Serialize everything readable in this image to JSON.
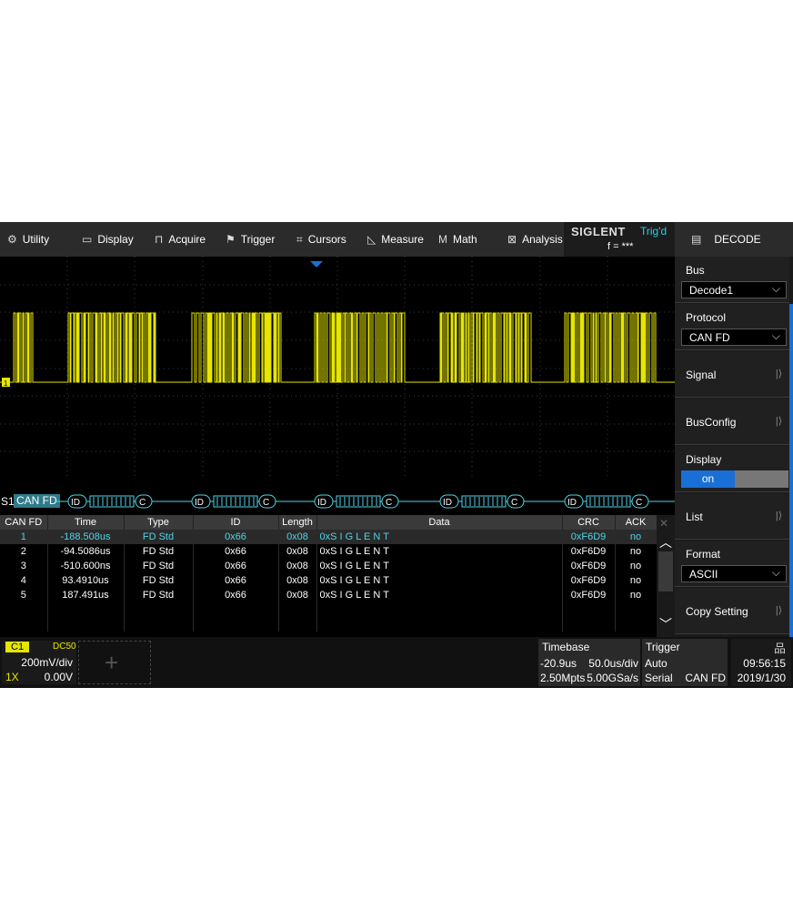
{
  "menu": {
    "items": [
      {
        "label": "Utility",
        "icon": "gear-icon"
      },
      {
        "label": "Display",
        "icon": "monitor-icon"
      },
      {
        "label": "Acquire",
        "icon": "acquire-icon"
      },
      {
        "label": "Trigger",
        "icon": "flag-icon"
      },
      {
        "label": "Cursors",
        "icon": "crosshair-icon"
      },
      {
        "label": "Measure",
        "icon": "measure-icon"
      },
      {
        "label": "Math",
        "icon": "math-icon"
      },
      {
        "label": "Analysis",
        "icon": "analysis-icon"
      }
    ]
  },
  "brand": {
    "logo": "SIGLENT",
    "status": "Trig'd",
    "freq": "f = ***"
  },
  "panel": {
    "title": "DECODE",
    "bus_label": "Bus",
    "bus_value": "Decode1",
    "protocol_label": "Protocol",
    "protocol_value": "CAN FD",
    "signal_label": "Signal",
    "busconfig_label": "BusConfig",
    "display_label": "Display",
    "display_value": "on",
    "list_label": "List",
    "format_label": "Format",
    "format_value": "ASCII",
    "copy_label": "Copy Setting"
  },
  "bus_trace": {
    "label": "S1",
    "protocol": "CAN FD",
    "id_tag": "ID",
    "crc_tag": "C"
  },
  "table": {
    "headers": [
      "CAN FD",
      "Time",
      "Type",
      "ID",
      "Length",
      "Data",
      "CRC",
      "ACK"
    ],
    "rows": [
      [
        "1",
        "-188.508us",
        "FD Std",
        "0x66",
        "0x08",
        "0xS I G L E N T",
        "0xF6D9",
        "no"
      ],
      [
        "2",
        "-94.5086us",
        "FD Std",
        "0x66",
        "0x08",
        "0xS I G L E N T",
        "0xF6D9",
        "no"
      ],
      [
        "3",
        "-510.600ns",
        "FD Std",
        "0x66",
        "0x08",
        "0xS I G L E N T",
        "0xF6D9",
        "no"
      ],
      [
        "4",
        "93.4910us",
        "FD Std",
        "0x66",
        "0x08",
        "0xS I G L E N T",
        "0xF6D9",
        "no"
      ],
      [
        "5",
        "187.491us",
        "FD Std",
        "0x66",
        "0x08",
        "0xS I G L E N T",
        "0xF6D9",
        "no"
      ]
    ]
  },
  "channel": {
    "name": "C1",
    "coupling": "DC50",
    "scale": "200mV/div",
    "probe": "1X",
    "offset": "0.00V"
  },
  "timebase": {
    "label": "Timebase",
    "delay": "-20.9us",
    "scale": "50.0us/div",
    "memory": "2.50Mpts",
    "rate": "5.00GSa/s"
  },
  "trigger": {
    "label": "Trigger",
    "mode": "Auto",
    "type": "Serial",
    "source": "CAN FD"
  },
  "clock": {
    "time": "09:56:15",
    "date": "2019/1/30"
  },
  "colors": {
    "trace": "#e6e600",
    "accent": "#1a6fd6",
    "decode": "#4fd3e8"
  }
}
